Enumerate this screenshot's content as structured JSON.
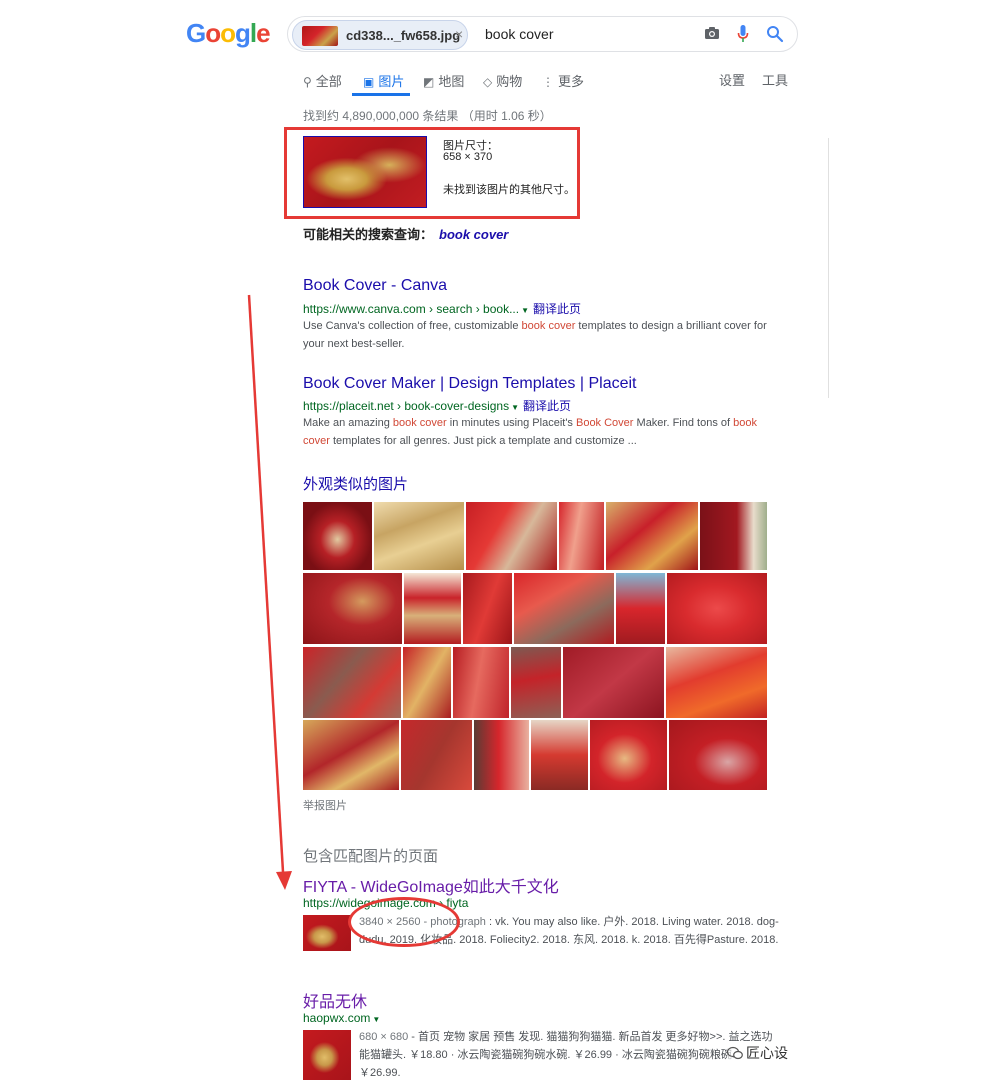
{
  "logo": {
    "letters": [
      {
        "ch": "G",
        "color": "#4285f4"
      },
      {
        "ch": "o",
        "color": "#ea4335"
      },
      {
        "ch": "o",
        "color": "#fbbc05"
      },
      {
        "ch": "g",
        "color": "#4285f4"
      },
      {
        "ch": "l",
        "color": "#34a853"
      },
      {
        "ch": "e",
        "color": "#ea4335"
      }
    ]
  },
  "search": {
    "chip_name": "cd338..._fw658.jpg",
    "chip_close": "×",
    "query": "book cover"
  },
  "tabs": [
    {
      "icon": "⚲",
      "label": "全部"
    },
    {
      "icon": "▣",
      "label": "图片"
    },
    {
      "icon": "◩",
      "label": "地图"
    },
    {
      "icon": "◇",
      "label": "购物"
    },
    {
      "icon": "⋮",
      "label": "更多"
    }
  ],
  "tools": {
    "settings": "设置",
    "tools": "工具"
  },
  "stats": "找到约 4,890,000,000 条结果 （用时 1.06 秒）",
  "image_info": {
    "label": "图片尺寸：",
    "size": "658 × 370",
    "no_other": "未找到该图片的其他尺寸。"
  },
  "related": {
    "label": "可能相关的搜索查询：",
    "query": "book cover"
  },
  "results": [
    {
      "title": "Book Cover - Canva",
      "url": "https://www.canva.com › search › book...",
      "translate": "翻译此页",
      "snippet": [
        {
          "t": "Use Canva's collection of free, customizable ",
          "hl": false
        },
        {
          "t": "book cover",
          "hl": true
        },
        {
          "t": " templates to design a brilliant cover for your next best-seller.",
          "hl": false
        }
      ]
    },
    {
      "title": "Book Cover Maker | Design Templates | Placeit",
      "url": "https://placeit.net › book-cover-designs",
      "translate": "翻译此页",
      "snippet": [
        {
          "t": "Make an amazing ",
          "hl": false
        },
        {
          "t": "book cover",
          "hl": true
        },
        {
          "t": " in minutes using Placeit's ",
          "hl": false
        },
        {
          "t": "Book Cover",
          "hl": true
        },
        {
          "t": " Maker. Find tons of ",
          "hl": false
        },
        {
          "t": "book cover",
          "hl": true
        },
        {
          "t": " templates for all genres. Just pick a template and customize ...",
          "hl": false
        }
      ]
    }
  ],
  "similar": {
    "title": "外观类似的图片",
    "report": "举报图片"
  },
  "matching": {
    "title": "包含匹配图片的页面",
    "pages": [
      {
        "title": "FIYTA - WideGoImage如此大千文化",
        "url": "https://widegoimage.com › fiyta",
        "meta": "3840 × 2560 - photograph",
        "snippet": " : vk. You may also like. 户外. 2018. Living water. 2018. dog-dudu. 2019. 化妆品. 2018. Foliecity2. 2018. 东风. 2018. k. 2018. 百先得Pasture. 2018."
      },
      {
        "title": "好品无休",
        "url": "haopwx.com",
        "meta": "680 × 680",
        "snippet": " - 首页 宠物 家居 预售 发现. 猫猫狗狗猫猫. 新品首发 更多好物>>. 益之选功能猫罐头. ￥18.80 · 冰云陶瓷猫碗狗碗水碗. ￥26.99 · 冰云陶瓷猫碗狗碗粮碗. ￥26.99."
      }
    ]
  },
  "watermark": "匠心设",
  "colors": {
    "link": "#1a0dab",
    "visited": "#681da8",
    "url_green": "#006621",
    "highlight": "#d14836",
    "annotation_red": "#e53935",
    "tab_active": "#1a73e8"
  }
}
